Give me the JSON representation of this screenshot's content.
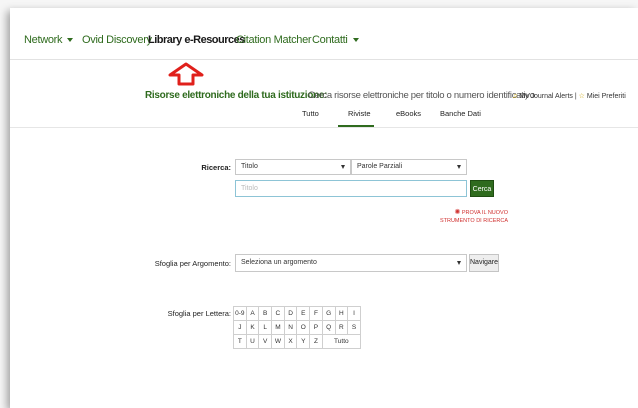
{
  "nav": {
    "items": [
      {
        "label": "Network",
        "has_caret": true
      },
      {
        "label": "Ovid Discovery",
        "has_caret": false
      },
      {
        "label": "Library e-Resources",
        "has_caret": false,
        "active": true
      },
      {
        "label": "Citation Matcher",
        "has_caret": false
      },
      {
        "label": "Contatti",
        "has_caret": true
      }
    ]
  },
  "header": {
    "section_label": "Risorse elettroniche della tua istituzione:",
    "section_desc": "Cerca risorse elettroniche per titolo o numero identificativo",
    "alerts": "My Journal Alerts",
    "separator": "|",
    "favorites": "Miei Preferiti"
  },
  "tabs": [
    "Tutto",
    "Riviste",
    "eBooks",
    "Banche Dati"
  ],
  "search": {
    "label": "Ricerca:",
    "field_select": "Titolo",
    "mode_select": "Parole Parziali",
    "placeholder": "Titolo",
    "button": "Cerca",
    "promo_line1": "Prova il nuovo",
    "promo_line2": "strumento di ricerca"
  },
  "browse_subject": {
    "label": "Sfoglia per Argomento:",
    "select": "Seleziona un argomento",
    "button": "Navigare"
  },
  "browse_letter": {
    "label": "Sfoglia per Lettera:",
    "rows": [
      [
        "0-9",
        "A",
        "B",
        "C",
        "D",
        "E",
        "F",
        "G",
        "H",
        "I"
      ],
      [
        "J",
        "K",
        "L",
        "M",
        "N",
        "O",
        "P",
        "Q",
        "R",
        "S"
      ],
      [
        "T",
        "U",
        "V",
        "W",
        "X",
        "Y",
        "Z",
        "Tutto"
      ]
    ]
  },
  "colors": {
    "brand_green": "#2f6b1e",
    "promo_red": "#d0302f",
    "arrow_red": "#e0201b"
  }
}
